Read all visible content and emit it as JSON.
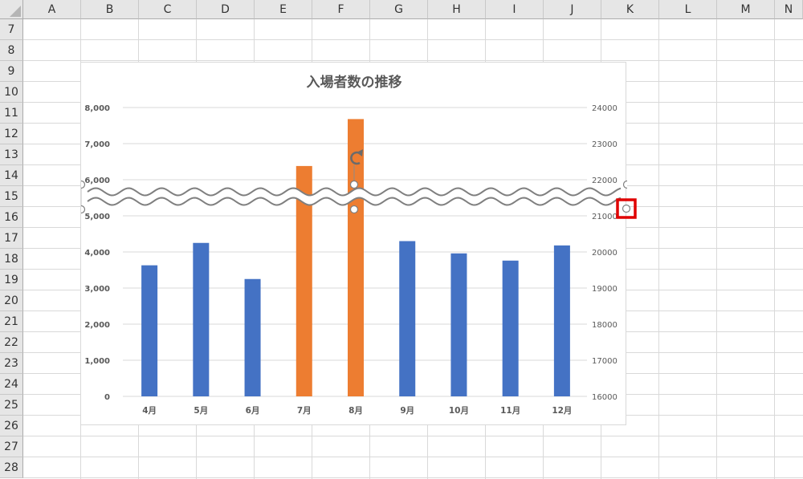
{
  "spreadsheet": {
    "corner_label": "",
    "columns": [
      "A",
      "B",
      "C",
      "D",
      "E",
      "F",
      "G",
      "H",
      "I",
      "J",
      "K",
      "L",
      "M",
      "N"
    ],
    "rows": [
      "7",
      "8",
      "9",
      "10",
      "11",
      "12",
      "13",
      "14",
      "15",
      "16",
      "17",
      "18",
      "19",
      "20",
      "21",
      "22",
      "23",
      "24",
      "25",
      "26",
      "27",
      "28"
    ]
  },
  "colors": {
    "normal_bar": "#4472c4",
    "highlight_bar": "#ed7d31",
    "selection_box": "#e00000",
    "gridline": "#d9d9d9"
  },
  "chart_data": {
    "type": "bar",
    "title": "入場者数の推移",
    "categories": [
      "4月",
      "5月",
      "6月",
      "7月",
      "8月",
      "9月",
      "10月",
      "11月",
      "12月"
    ],
    "values": [
      3630,
      4250,
      3250,
      6380,
      7680,
      4300,
      3960,
      3760,
      4180
    ],
    "highlight": [
      false,
      false,
      false,
      true,
      true,
      false,
      false,
      false,
      false
    ],
    "primary_axis": {
      "min": 0,
      "max": 8000,
      "ticks": [
        "0",
        "1,000",
        "2,000",
        "3,000",
        "4,000",
        "5,000",
        "6,000",
        "7,000",
        "8,000"
      ]
    },
    "secondary_axis": {
      "min": 16000,
      "max": 24000,
      "ticks": [
        "16000",
        "17000",
        "18000",
        "19000",
        "20000",
        "21000",
        "22000",
        "23000",
        "24000"
      ]
    },
    "grid": true,
    "break_shape": "double-wave"
  }
}
